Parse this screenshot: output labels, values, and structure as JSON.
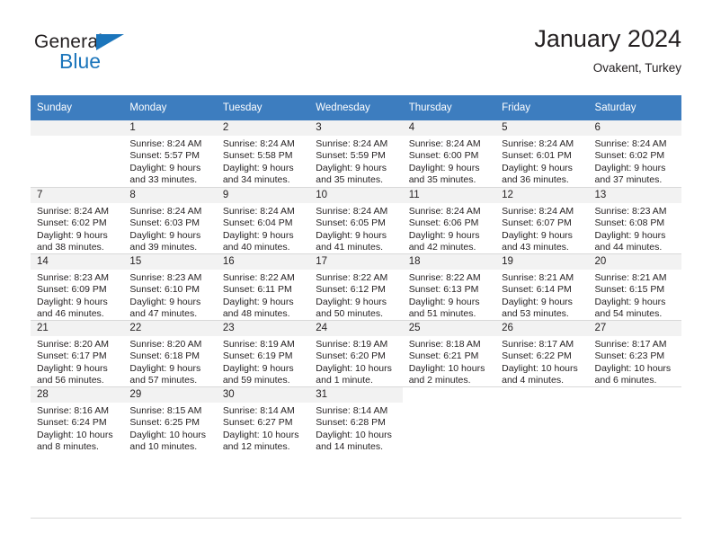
{
  "brand": {
    "name_dark": "General",
    "name_blue": "Blue",
    "accent_color": "#1b75bb"
  },
  "header": {
    "title": "January 2024",
    "subtitle": "Ovakent, Turkey"
  },
  "theme": {
    "header_row_color": "#3d7dbf",
    "daynum_band_color": "#f2f2f2",
    "text_color": "#231f20",
    "grid_line_color": "#d9d9d9"
  },
  "weekday_headers": [
    "Sunday",
    "Monday",
    "Tuesday",
    "Wednesday",
    "Thursday",
    "Friday",
    "Saturday"
  ],
  "weeks": [
    [
      {
        "day": "",
        "lines": []
      },
      {
        "day": "1",
        "lines": [
          "Sunrise: 8:24 AM",
          "Sunset: 5:57 PM",
          "Daylight: 9 hours",
          "and 33 minutes."
        ]
      },
      {
        "day": "2",
        "lines": [
          "Sunrise: 8:24 AM",
          "Sunset: 5:58 PM",
          "Daylight: 9 hours",
          "and 34 minutes."
        ]
      },
      {
        "day": "3",
        "lines": [
          "Sunrise: 8:24 AM",
          "Sunset: 5:59 PM",
          "Daylight: 9 hours",
          "and 35 minutes."
        ]
      },
      {
        "day": "4",
        "lines": [
          "Sunrise: 8:24 AM",
          "Sunset: 6:00 PM",
          "Daylight: 9 hours",
          "and 35 minutes."
        ]
      },
      {
        "day": "5",
        "lines": [
          "Sunrise: 8:24 AM",
          "Sunset: 6:01 PM",
          "Daylight: 9 hours",
          "and 36 minutes."
        ]
      },
      {
        "day": "6",
        "lines": [
          "Sunrise: 8:24 AM",
          "Sunset: 6:02 PM",
          "Daylight: 9 hours",
          "and 37 minutes."
        ]
      }
    ],
    [
      {
        "day": "7",
        "lines": [
          "Sunrise: 8:24 AM",
          "Sunset: 6:02 PM",
          "Daylight: 9 hours",
          "and 38 minutes."
        ]
      },
      {
        "day": "8",
        "lines": [
          "Sunrise: 8:24 AM",
          "Sunset: 6:03 PM",
          "Daylight: 9 hours",
          "and 39 minutes."
        ]
      },
      {
        "day": "9",
        "lines": [
          "Sunrise: 8:24 AM",
          "Sunset: 6:04 PM",
          "Daylight: 9 hours",
          "and 40 minutes."
        ]
      },
      {
        "day": "10",
        "lines": [
          "Sunrise: 8:24 AM",
          "Sunset: 6:05 PM",
          "Daylight: 9 hours",
          "and 41 minutes."
        ]
      },
      {
        "day": "11",
        "lines": [
          "Sunrise: 8:24 AM",
          "Sunset: 6:06 PM",
          "Daylight: 9 hours",
          "and 42 minutes."
        ]
      },
      {
        "day": "12",
        "lines": [
          "Sunrise: 8:24 AM",
          "Sunset: 6:07 PM",
          "Daylight: 9 hours",
          "and 43 minutes."
        ]
      },
      {
        "day": "13",
        "lines": [
          "Sunrise: 8:23 AM",
          "Sunset: 6:08 PM",
          "Daylight: 9 hours",
          "and 44 minutes."
        ]
      }
    ],
    [
      {
        "day": "14",
        "lines": [
          "Sunrise: 8:23 AM",
          "Sunset: 6:09 PM",
          "Daylight: 9 hours",
          "and 46 minutes."
        ]
      },
      {
        "day": "15",
        "lines": [
          "Sunrise: 8:23 AM",
          "Sunset: 6:10 PM",
          "Daylight: 9 hours",
          "and 47 minutes."
        ]
      },
      {
        "day": "16",
        "lines": [
          "Sunrise: 8:22 AM",
          "Sunset: 6:11 PM",
          "Daylight: 9 hours",
          "and 48 minutes."
        ]
      },
      {
        "day": "17",
        "lines": [
          "Sunrise: 8:22 AM",
          "Sunset: 6:12 PM",
          "Daylight: 9 hours",
          "and 50 minutes."
        ]
      },
      {
        "day": "18",
        "lines": [
          "Sunrise: 8:22 AM",
          "Sunset: 6:13 PM",
          "Daylight: 9 hours",
          "and 51 minutes."
        ]
      },
      {
        "day": "19",
        "lines": [
          "Sunrise: 8:21 AM",
          "Sunset: 6:14 PM",
          "Daylight: 9 hours",
          "and 53 minutes."
        ]
      },
      {
        "day": "20",
        "lines": [
          "Sunrise: 8:21 AM",
          "Sunset: 6:15 PM",
          "Daylight: 9 hours",
          "and 54 minutes."
        ]
      }
    ],
    [
      {
        "day": "21",
        "lines": [
          "Sunrise: 8:20 AM",
          "Sunset: 6:17 PM",
          "Daylight: 9 hours",
          "and 56 minutes."
        ]
      },
      {
        "day": "22",
        "lines": [
          "Sunrise: 8:20 AM",
          "Sunset: 6:18 PM",
          "Daylight: 9 hours",
          "and 57 minutes."
        ]
      },
      {
        "day": "23",
        "lines": [
          "Sunrise: 8:19 AM",
          "Sunset: 6:19 PM",
          "Daylight: 9 hours",
          "and 59 minutes."
        ]
      },
      {
        "day": "24",
        "lines": [
          "Sunrise: 8:19 AM",
          "Sunset: 6:20 PM",
          "Daylight: 10 hours",
          "and 1 minute."
        ]
      },
      {
        "day": "25",
        "lines": [
          "Sunrise: 8:18 AM",
          "Sunset: 6:21 PM",
          "Daylight: 10 hours",
          "and 2 minutes."
        ]
      },
      {
        "day": "26",
        "lines": [
          "Sunrise: 8:17 AM",
          "Sunset: 6:22 PM",
          "Daylight: 10 hours",
          "and 4 minutes."
        ]
      },
      {
        "day": "27",
        "lines": [
          "Sunrise: 8:17 AM",
          "Sunset: 6:23 PM",
          "Daylight: 10 hours",
          "and 6 minutes."
        ]
      }
    ],
    [
      {
        "day": "28",
        "lines": [
          "Sunrise: 8:16 AM",
          "Sunset: 6:24 PM",
          "Daylight: 10 hours",
          "and 8 minutes."
        ]
      },
      {
        "day": "29",
        "lines": [
          "Sunrise: 8:15 AM",
          "Sunset: 6:25 PM",
          "Daylight: 10 hours",
          "and 10 minutes."
        ]
      },
      {
        "day": "30",
        "lines": [
          "Sunrise: 8:14 AM",
          "Sunset: 6:27 PM",
          "Daylight: 10 hours",
          "and 12 minutes."
        ]
      },
      {
        "day": "31",
        "lines": [
          "Sunrise: 8:14 AM",
          "Sunset: 6:28 PM",
          "Daylight: 10 hours",
          "and 14 minutes."
        ]
      },
      {
        "day": "",
        "lines": []
      },
      {
        "day": "",
        "lines": []
      },
      {
        "day": "",
        "lines": []
      }
    ]
  ]
}
